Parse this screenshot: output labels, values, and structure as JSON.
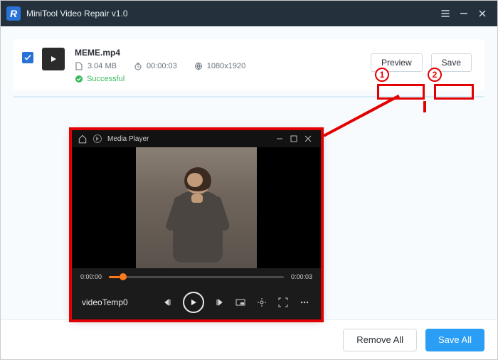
{
  "app": {
    "title": "MiniTool Video Repair v1.0",
    "logo_letter": "R"
  },
  "file": {
    "name": "MEME.mp4",
    "size": "3.04 MB",
    "duration": "00:00:03",
    "resolution": "1080x1920",
    "status": "Successful"
  },
  "actions": {
    "preview": "Preview",
    "save": "Save"
  },
  "player": {
    "app_name": "Media Player",
    "current_time": "0:00:00",
    "total_time": "0:00:03",
    "temp_name": "videoTemp0"
  },
  "footer": {
    "remove_all": "Remove All",
    "save_all": "Save All"
  },
  "annotations": {
    "step1": "1",
    "step2": "2"
  }
}
